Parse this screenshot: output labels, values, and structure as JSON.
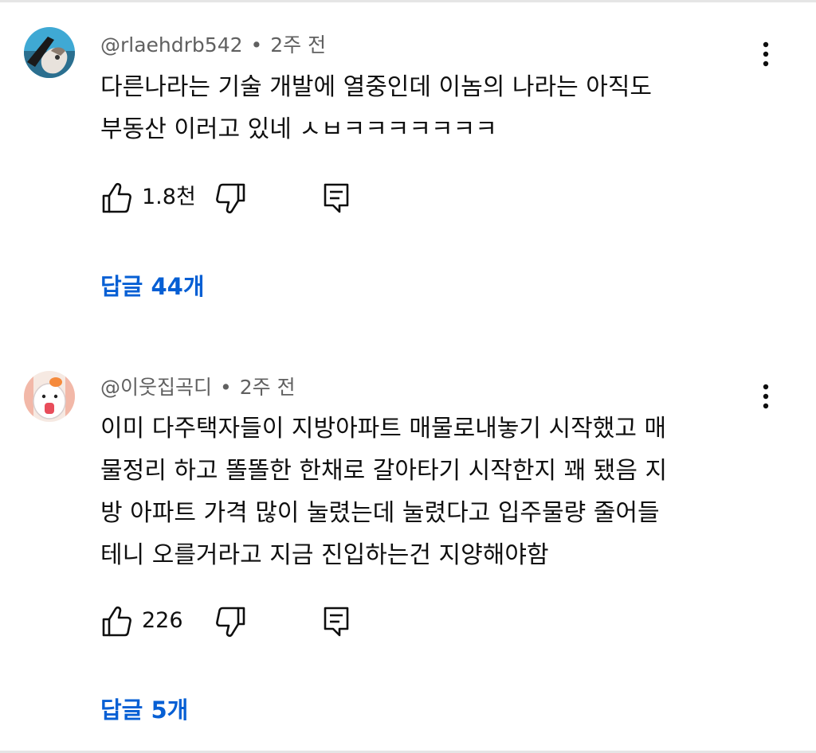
{
  "comments": [
    {
      "author": "@rlaehdrb542",
      "separator": "•",
      "time": "2주 전",
      "text": "다른나라는 기술 개발에 열중인데 이놈의 나라는 아직도\n부동산 이러고 있네 ㅅㅂㅋㅋㅋㅋㅋㅋㅋ",
      "likes": "1.8천",
      "replies_label": "답글 44개",
      "avatar_icon": "avatar-photo-icon"
    },
    {
      "author": "@이웃집곡디",
      "separator": "•",
      "time": "2주 전",
      "text": "이미 다주택자들이 지방아파트 매물로내놓기 시작했고 매\n물정리 하고 똘똘한 한채로 갈아타기 시작한지 꽤 됐음 지\n방 아파트 가격 많이 눌렸는데 눌렸다고 입주물량 줄어들\n테니 오를거라고 지금 진입하는건 지양해야함",
      "likes": "226",
      "replies_label": "답글 5개",
      "avatar_icon": "avatar-hamster-icon"
    }
  ],
  "icons": {
    "like": "thumbs-up-icon",
    "dislike": "thumbs-down-icon",
    "reply": "reply-icon",
    "more": "more-vertical-icon"
  },
  "colors": {
    "link": "#065fd4",
    "meta": "#606060",
    "text": "#0f0f0f",
    "divider": "#e5e5e5"
  }
}
